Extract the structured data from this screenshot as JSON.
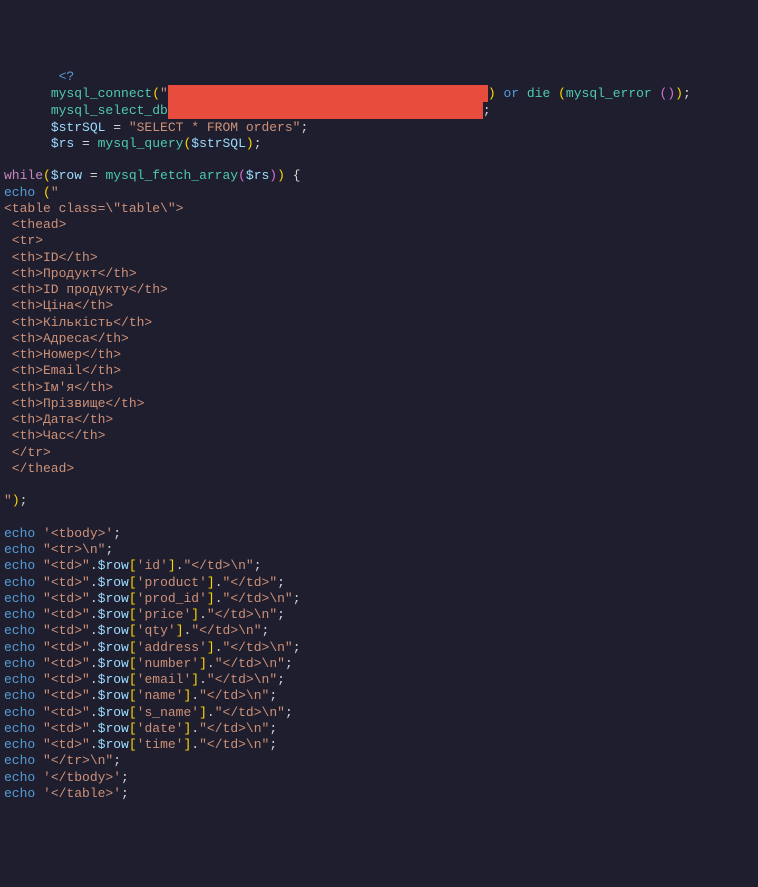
{
  "code": {
    "l1_indent": "       ",
    "l1_php": "<?",
    "l2_indent": "      ",
    "l2_func": "mysql_connect",
    "l2_quote": "\"",
    "l2_or": " or ",
    "l2_die": "die ",
    "l2_err": "mysql_error ",
    "l2_end": ";",
    "l3_indent": "      ",
    "l3_func": "mysql_select_db",
    "l3_end": ";",
    "l4_indent": "      ",
    "l4_var": "$strSQL",
    "l4_eq": " = ",
    "l4_str": "\"SELECT * FROM orders\"",
    "l4_end": ";",
    "l5_indent": "      ",
    "l5_var": "$rs",
    "l5_eq": " = ",
    "l5_func": "mysql_query",
    "l5_arg": "$strSQL",
    "l5_end": ";",
    "l6_while": "while",
    "l6_var": "$row",
    "l6_eq": " = ",
    "l6_func": "mysql_fetch_array",
    "l6_arg": "$rs",
    "l6_end": " {",
    "l7_echo": "echo ",
    "l7_open": "(",
    "l7_q": "\"",
    "table_open": "<table class=\\\"table\\\">",
    "thead_open": " <thead>",
    "tr_open": " <tr>",
    "th_id": " <th>ID</th>",
    "th_product": " <th>Продукт</th>",
    "th_prodid": " <th>ID продукту</th>",
    "th_price": " <th>Ціна</th>",
    "th_qty": " <th>Кількість</th>",
    "th_address": " <th>Адреса</th>",
    "th_number": " <th>Номер</th>",
    "th_email": " <th>Email</th>",
    "th_name": " <th>Ім'я</th>",
    "th_sname": " <th>Прізвище</th>",
    "th_date": " <th>Дата</th>",
    "th_time": " <th>Час</th>",
    "tr_close": " </tr>",
    "thead_close": " </thead>",
    "close_echo": "\");",
    "echo": "echo ",
    "tbody_open": "'<tbody>'",
    "tr_n": "\"<tr>\\n\"",
    "td_open": "\"<td>\"",
    "dot": ".",
    "row": "$row",
    "key_id": "'id'",
    "key_product": "'product'",
    "key_prodid": "'prod_id'",
    "key_price": "'price'",
    "key_qty": "'qty'",
    "key_address": "'address'",
    "key_number": "'number'",
    "key_email": "'email'",
    "key_name": "'name'",
    "key_sname": "'s_name'",
    "key_date": "'date'",
    "key_time": "'time'",
    "td_close_n": "\"</td>\\n\"",
    "td_close": "\"</td>\"",
    "tr_close_n": "\"</tr>\\n\"",
    "tbody_close": "'</tbody>'",
    "table_close": "'</table>'",
    "semi": ";"
  }
}
